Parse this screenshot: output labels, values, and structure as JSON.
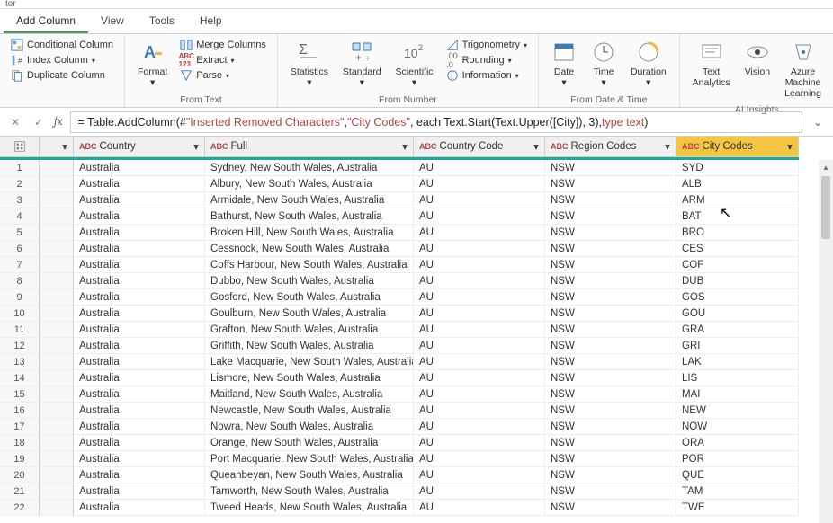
{
  "title_suffix": "tor",
  "tabs": {
    "add_column": "Add Column",
    "view": "View",
    "tools": "Tools",
    "help": "Help"
  },
  "ribbon": {
    "general": {
      "conditional": "Conditional Column",
      "index": "Index Column",
      "duplicate": "Duplicate Column"
    },
    "from_text": {
      "label": "From Text",
      "format": "Format",
      "merge": "Merge Columns",
      "extract": "Extract",
      "parse": "Parse"
    },
    "from_number": {
      "label": "From Number",
      "statistics": "Statistics",
      "standard": "Standard",
      "scientific": "Scientific",
      "trig": "Trigonometry",
      "rounding": "Rounding",
      "info": "Information"
    },
    "from_datetime": {
      "label": "From Date & Time",
      "date": "Date",
      "time": "Time",
      "duration": "Duration"
    },
    "ai": {
      "label": "AI Insights",
      "text_analytics": "Text\nAnalytics",
      "vision": "Vision",
      "aml": "Azure Machine\nLearning"
    }
  },
  "formula": {
    "prefix": "= Table.AddColumn(#",
    "arg1": "\"Inserted Removed Characters\"",
    "sep1": ", ",
    "arg2": "\"City Codes\"",
    "sep2": ", each Text.Start(Text.Upper([City]), 3), ",
    "kw": "type text",
    "suffix": ")"
  },
  "columns": {
    "country": "Country",
    "full": "Full",
    "country_code": "Country Code",
    "region_codes": "Region Codes",
    "city_codes": "City Codes"
  },
  "type_label": "ABC",
  "rows": [
    {
      "n": 1,
      "country": "Australia",
      "full": "Sydney, New South Wales, Australia",
      "cc": "AU",
      "rc": "NSW",
      "city": "SYD"
    },
    {
      "n": 2,
      "country": "Australia",
      "full": "Albury, New South Wales, Australia",
      "cc": "AU",
      "rc": "NSW",
      "city": "ALB"
    },
    {
      "n": 3,
      "country": "Australia",
      "full": "Armidale, New South Wales, Australia",
      "cc": "AU",
      "rc": "NSW",
      "city": "ARM"
    },
    {
      "n": 4,
      "country": "Australia",
      "full": "Bathurst, New South Wales, Australia",
      "cc": "AU",
      "rc": "NSW",
      "city": "BAT"
    },
    {
      "n": 5,
      "country": "Australia",
      "full": "Broken Hill, New South Wales, Australia",
      "cc": "AU",
      "rc": "NSW",
      "city": "BRO"
    },
    {
      "n": 6,
      "country": "Australia",
      "full": "Cessnock, New South Wales, Australia",
      "cc": "AU",
      "rc": "NSW",
      "city": "CES"
    },
    {
      "n": 7,
      "country": "Australia",
      "full": "Coffs Harbour, New South Wales, Australia",
      "cc": "AU",
      "rc": "NSW",
      "city": "COF"
    },
    {
      "n": 8,
      "country": "Australia",
      "full": "Dubbo, New South Wales, Australia",
      "cc": "AU",
      "rc": "NSW",
      "city": "DUB"
    },
    {
      "n": 9,
      "country": "Australia",
      "full": "Gosford, New South Wales, Australia",
      "cc": "AU",
      "rc": "NSW",
      "city": "GOS"
    },
    {
      "n": 10,
      "country": "Australia",
      "full": "Goulburn, New South Wales, Australia",
      "cc": "AU",
      "rc": "NSW",
      "city": "GOU"
    },
    {
      "n": 11,
      "country": "Australia",
      "full": "Grafton, New South Wales, Australia",
      "cc": "AU",
      "rc": "NSW",
      "city": "GRA"
    },
    {
      "n": 12,
      "country": "Australia",
      "full": "Griffith, New South Wales, Australia",
      "cc": "AU",
      "rc": "NSW",
      "city": "GRI"
    },
    {
      "n": 13,
      "country": "Australia",
      "full": "Lake Macquarie, New South Wales, Australia",
      "cc": "AU",
      "rc": "NSW",
      "city": "LAK"
    },
    {
      "n": 14,
      "country": "Australia",
      "full": "Lismore, New South Wales, Australia",
      "cc": "AU",
      "rc": "NSW",
      "city": "LIS"
    },
    {
      "n": 15,
      "country": "Australia",
      "full": "Maitland, New South Wales, Australia",
      "cc": "AU",
      "rc": "NSW",
      "city": "MAI"
    },
    {
      "n": 16,
      "country": "Australia",
      "full": "Newcastle, New South Wales, Australia",
      "cc": "AU",
      "rc": "NSW",
      "city": "NEW"
    },
    {
      "n": 17,
      "country": "Australia",
      "full": "Nowra, New South Wales, Australia",
      "cc": "AU",
      "rc": "NSW",
      "city": "NOW"
    },
    {
      "n": 18,
      "country": "Australia",
      "full": "Orange, New South Wales, Australia",
      "cc": "AU",
      "rc": "NSW",
      "city": "ORA"
    },
    {
      "n": 19,
      "country": "Australia",
      "full": "Port Macquarie, New South Wales, Australia",
      "cc": "AU",
      "rc": "NSW",
      "city": "POR"
    },
    {
      "n": 20,
      "country": "Australia",
      "full": "Queanbeyan, New South Wales, Australia",
      "cc": "AU",
      "rc": "NSW",
      "city": "QUE"
    },
    {
      "n": 21,
      "country": "Australia",
      "full": "Tamworth, New South Wales, Australia",
      "cc": "AU",
      "rc": "NSW",
      "city": "TAM"
    },
    {
      "n": 22,
      "country": "Australia",
      "full": "Tweed Heads, New South Wales, Australia",
      "cc": "AU",
      "rc": "NSW",
      "city": "TWE"
    }
  ]
}
